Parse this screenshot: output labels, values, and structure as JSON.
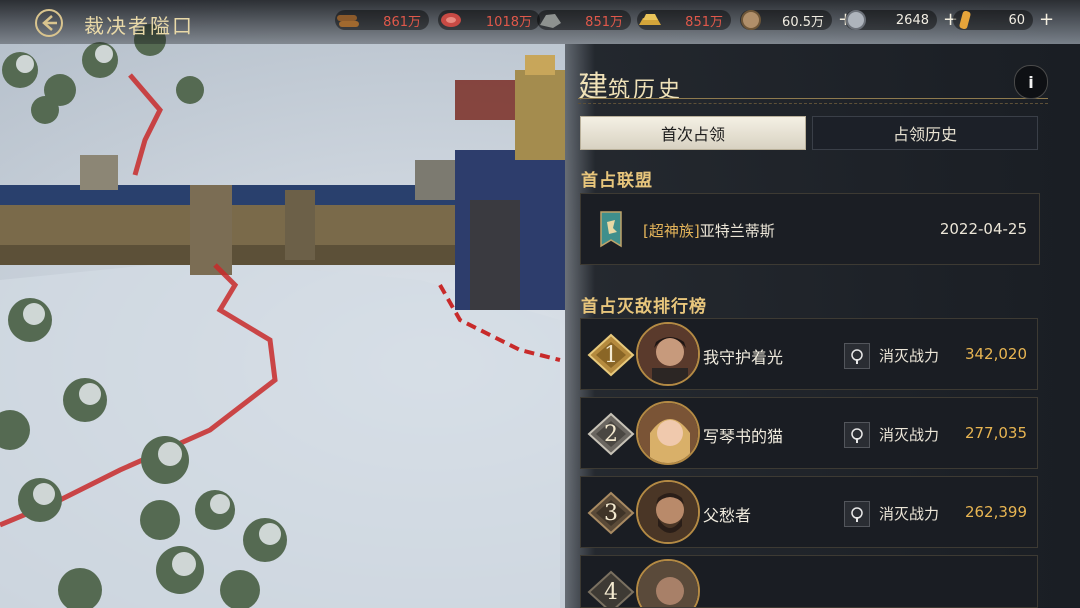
{
  "header": {
    "title": "裁决者隘口",
    "back_icon": "back-arrow-icon"
  },
  "resources": [
    {
      "icon": "wood-icon",
      "value": "861万",
      "color": "#e0584a"
    },
    {
      "icon": "meat-icon",
      "value": "1018万",
      "color": "#e0584a"
    },
    {
      "icon": "stone-icon",
      "value": "851万",
      "color": "#e0584a"
    },
    {
      "icon": "gold-bar-icon",
      "value": "851万",
      "color": "#e0584a"
    },
    {
      "icon": "coin-icon",
      "value": "60.5万",
      "color": "#f1ede2"
    },
    {
      "icon": "silver-coin-icon",
      "value": "2648",
      "color": "#f1ede2"
    },
    {
      "icon": "crystal-icon",
      "value": "60",
      "color": "#f1ede2"
    }
  ],
  "panel": {
    "title_first_char": "建",
    "title_rest": "筑历史",
    "info_label": "i",
    "tabs": [
      {
        "label": "首次占领",
        "selected": true
      },
      {
        "label": "占领历史",
        "selected": false
      }
    ],
    "first_alliance_heading": "首占联盟",
    "alliance": {
      "tag": "[超神族]",
      "name": "亚特兰蒂斯",
      "date": "2022-04-25"
    },
    "ranking_heading": "首占灭敌排行榜",
    "ranking": [
      {
        "rank": "1",
        "name": "我守护着光",
        "label": "消灭战力",
        "value": "342,020"
      },
      {
        "rank": "2",
        "name": "写琴书的猫",
        "label": "消灭战力",
        "value": "277,035"
      },
      {
        "rank": "3",
        "name": "父愁者",
        "label": "消灭战力",
        "value": "262,399"
      },
      {
        "rank": "4",
        "name": "",
        "label": "",
        "value": ""
      }
    ]
  },
  "colors": {
    "accent_gold": "#e8b552",
    "heading_gold": "#e8c67c",
    "deficit_red": "#e0584a"
  }
}
